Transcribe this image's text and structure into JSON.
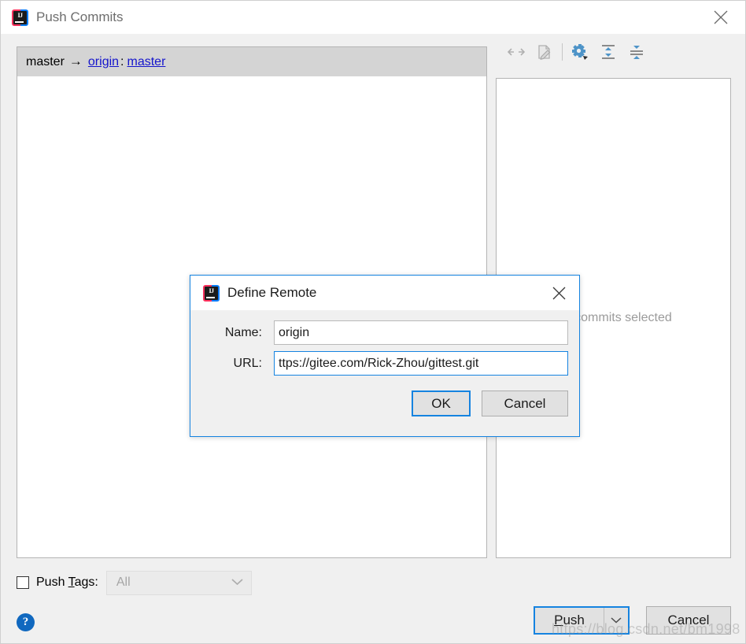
{
  "window": {
    "title": "Push Commits",
    "logo_text": "IJ",
    "close_icon": "close-icon"
  },
  "repo_row": {
    "source_branch": "master",
    "arrow": "→",
    "remote": "origin",
    "separator": ":",
    "target_branch": "master"
  },
  "detail_toolbar": {
    "buttons": [
      {
        "name": "collapse-selection-icon",
        "enabled": false
      },
      {
        "name": "show-diff-icon",
        "enabled": false
      },
      {
        "name": "settings-gear-icon",
        "enabled": true
      },
      {
        "name": "expand-all-icon",
        "enabled": true
      },
      {
        "name": "collapse-all-icon",
        "enabled": true
      }
    ]
  },
  "detail_panel": {
    "empty_text": "No commits selected"
  },
  "push_tags": {
    "checked": false,
    "label_prefix": "Push ",
    "label_mnemonic": "T",
    "label_suffix": "ags:",
    "combo_value": "All",
    "combo_enabled": false
  },
  "footer": {
    "help_label": "?",
    "push_label_prefix": "",
    "push_mnemonic": "P",
    "push_label_suffix": "ush",
    "push_dropdown_icon": "chevron-down-icon",
    "cancel_label": "Cancel"
  },
  "define_remote": {
    "title": "Define Remote",
    "close_icon": "close-icon",
    "name_label": "Name:",
    "name_value": "origin",
    "name_placeholder": "",
    "url_label": "URL:",
    "url_value": "ttps://gitee.com/Rick-Zhou/gittest.git",
    "url_full_value": "https://gitee.com/Rick-Zhou/gittest.git",
    "url_placeholder": "",
    "ok_label": "OK",
    "cancel_label": "Cancel"
  },
  "watermark": {
    "text": "https://blog.csdn.net/bm1998"
  },
  "colors": {
    "accent_blue": "#1583e0",
    "link_blue": "#1414cc",
    "header_gray": "#d4d4d4",
    "panel_bg": "#f0f0f0",
    "icon_blue": "#4e94c8",
    "icon_gray": "#b0b0b0",
    "help_blue": "#1068bf"
  }
}
